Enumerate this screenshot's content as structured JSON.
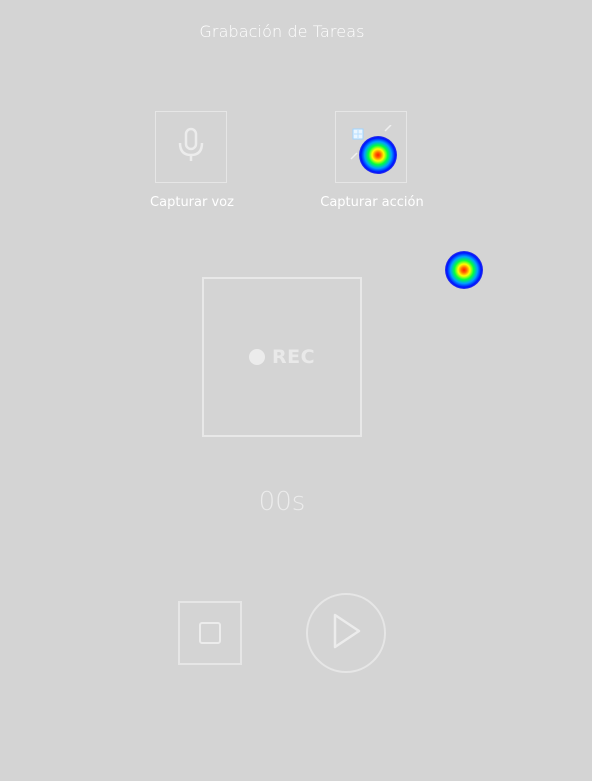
{
  "window": {
    "title": "Grabación de Tareas"
  },
  "capture": {
    "voice_label": "Capturar voz",
    "voice_icon": "microphone-icon",
    "action_label": "Capturar acción",
    "action_icon": "sparkle-cursor-icon"
  },
  "record": {
    "label": "REC",
    "icon": "record-dot-icon"
  },
  "timer": {
    "value": "00s"
  },
  "controls": {
    "stop_icon": "stop-icon",
    "play_icon": "play-icon"
  }
}
